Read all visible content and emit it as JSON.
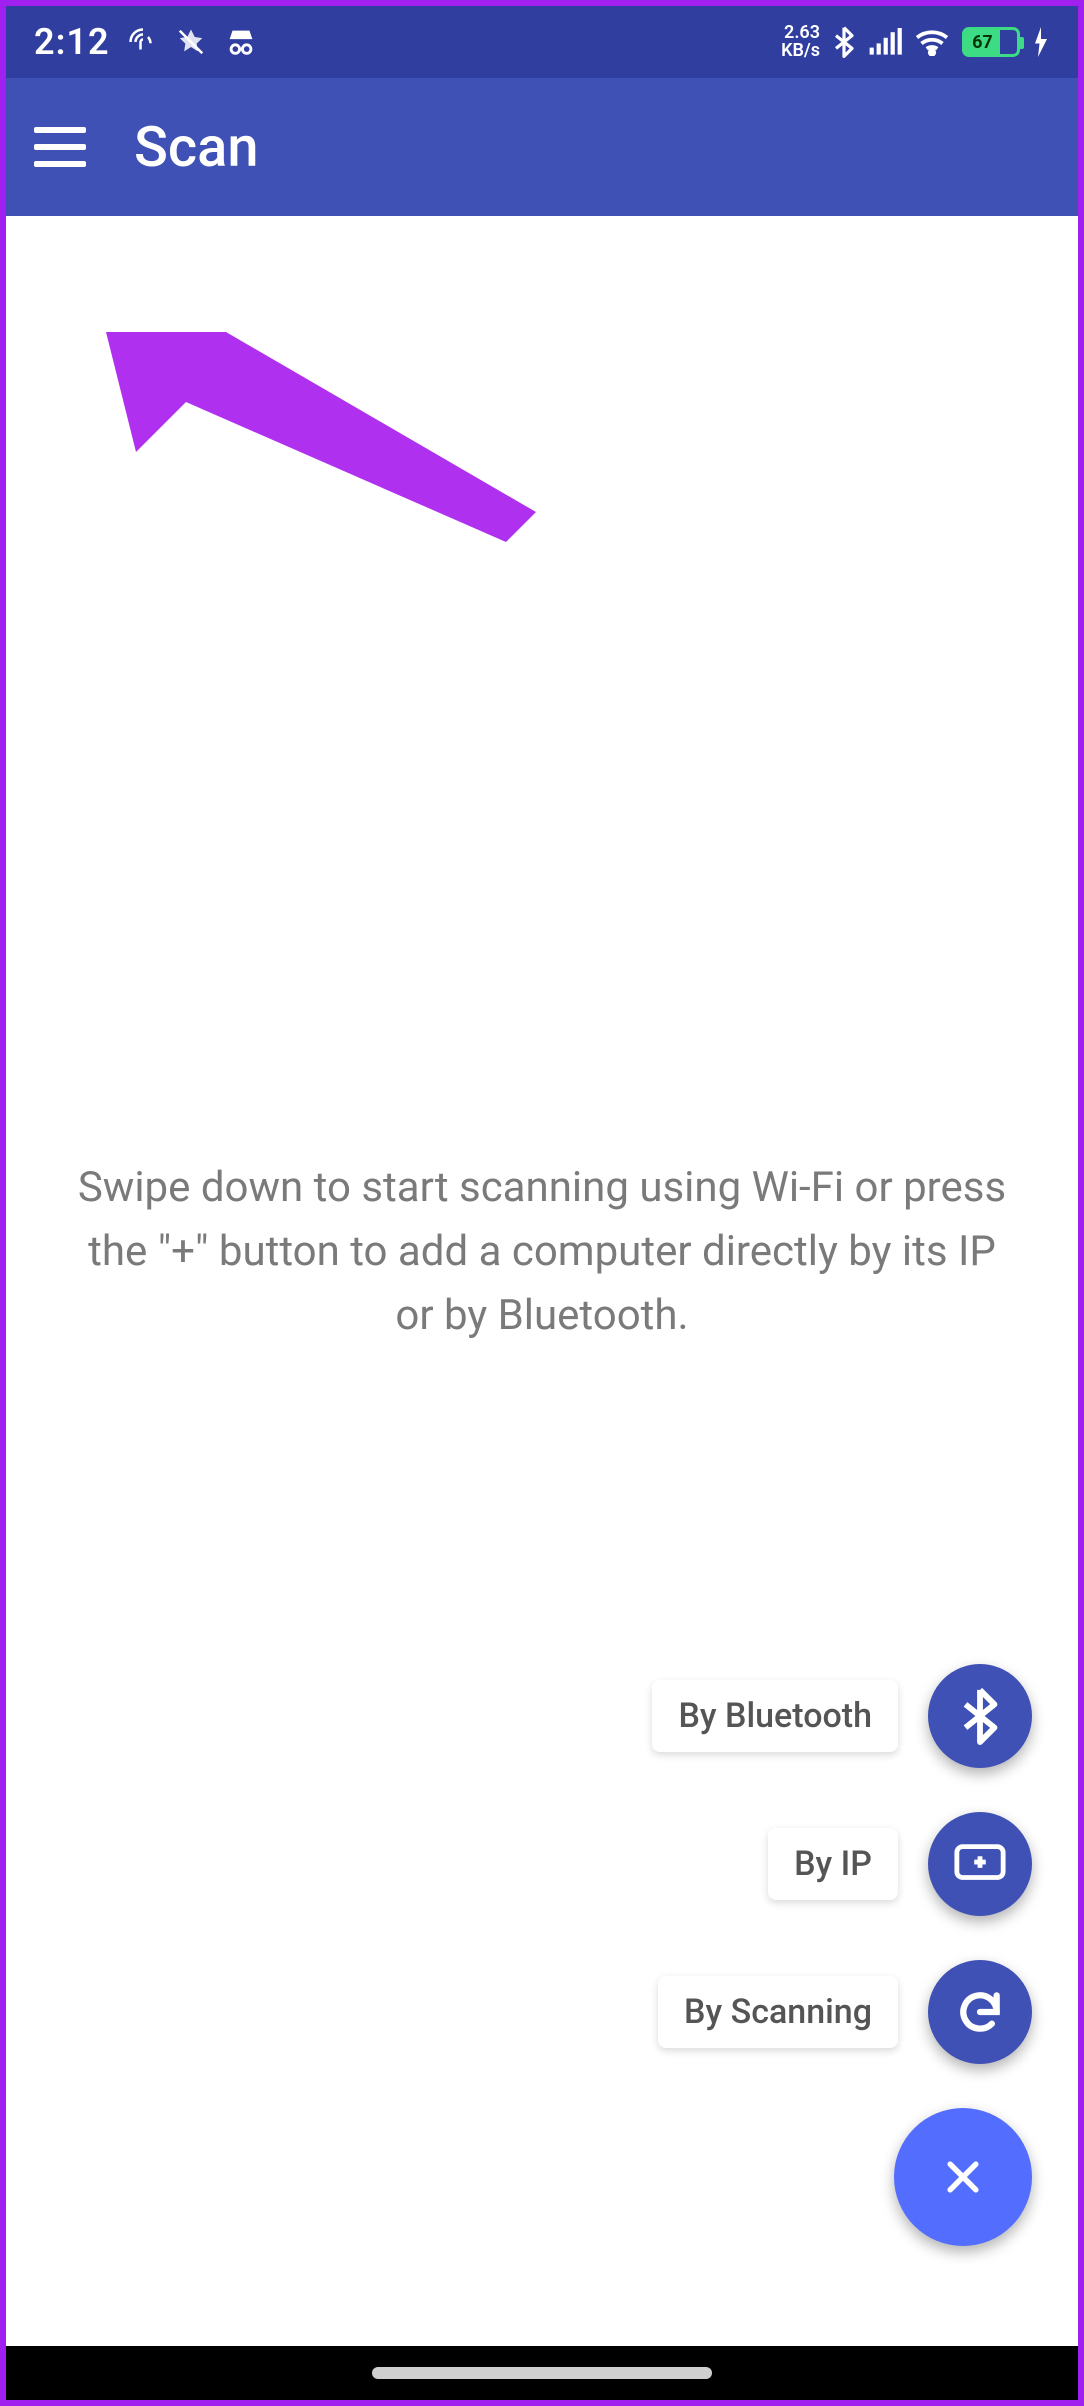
{
  "status": {
    "time": "2:12",
    "net_rate_top": "2.63",
    "net_rate_bottom": "KB/s",
    "battery_pct": "67"
  },
  "appbar": {
    "title": "Scan"
  },
  "hint": {
    "text": "Swipe down to start scanning using Wi-Fi or press the \"+\" button to add a computer directly by its IP or by Bluetooth."
  },
  "fab": {
    "bluetooth_label": "By Bluetooth",
    "ip_label": "By IP",
    "scanning_label": "By Scanning"
  }
}
